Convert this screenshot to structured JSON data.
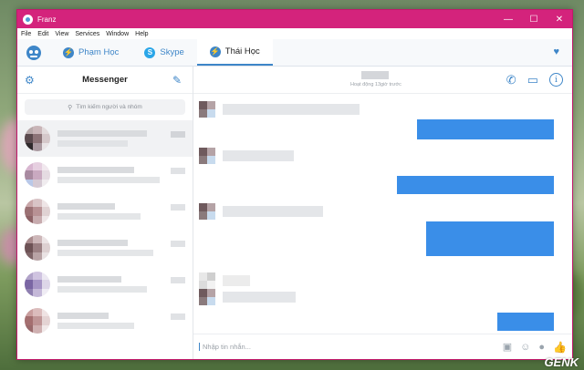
{
  "window": {
    "title": "Franz"
  },
  "window_controls": {
    "minimize": "—",
    "maximize": "☐",
    "close": "✕"
  },
  "menu": [
    "File",
    "Edit",
    "View",
    "Services",
    "Window",
    "Help"
  ],
  "tabs": [
    {
      "label": "Phạm Học",
      "icon": "messenger-icon",
      "active": false
    },
    {
      "label": "Skype",
      "icon": "skype-icon",
      "active": false
    },
    {
      "label": "Thái Học",
      "icon": "messenger-icon",
      "active": true
    }
  ],
  "sidebar": {
    "title": "Messenger",
    "search_placeholder": "Tìm kiếm người và nhóm"
  },
  "chat": {
    "status": "Hoạt động 13giờ trước",
    "composer_placeholder": "Nhập tin nhắn..."
  },
  "watermark": "GENK",
  "colors": {
    "titlebar": "#d4237c",
    "accent": "#3e86c8",
    "outgoing_bubble": "#3a8ee8"
  }
}
